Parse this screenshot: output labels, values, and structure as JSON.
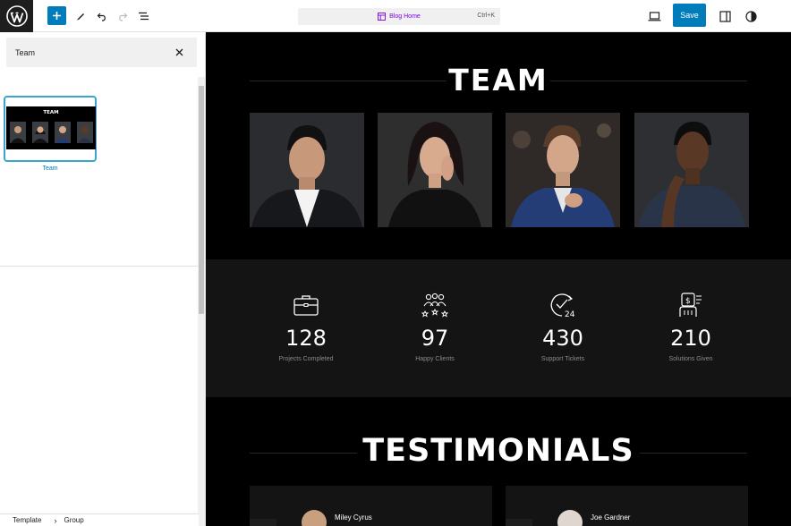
{
  "toolbar": {
    "document_title": "Blog Home",
    "shortcut": "Ctrl+K",
    "save_label": "Save"
  },
  "sidebar": {
    "search_value": "Team",
    "pattern_label": "Team",
    "thumbnail_title": "TEAM",
    "breadcrumb": [
      "Template",
      "Group"
    ]
  },
  "canvas": {
    "team_title": "TEAM",
    "stats": [
      {
        "value": "128",
        "label": "Projects Completed",
        "icon": "briefcase-icon"
      },
      {
        "value": "97",
        "label": "Happy Clients",
        "icon": "group-stars-icon"
      },
      {
        "value": "430",
        "label": "Support Tickets",
        "icon": "clock-24-icon"
      },
      {
        "value": "210",
        "label": "Solutions Given",
        "icon": "solution-icon"
      }
    ],
    "testimonials_title": "TESTIMONIALS",
    "testimonials": [
      {
        "name": "Miley Cyrus"
      },
      {
        "name": "Joe Gardner"
      }
    ]
  },
  "colors": {
    "accent": "#007cba",
    "canvas_bg": "#000000",
    "stats_bg": "#141414",
    "doc_title": "#7a00df"
  }
}
